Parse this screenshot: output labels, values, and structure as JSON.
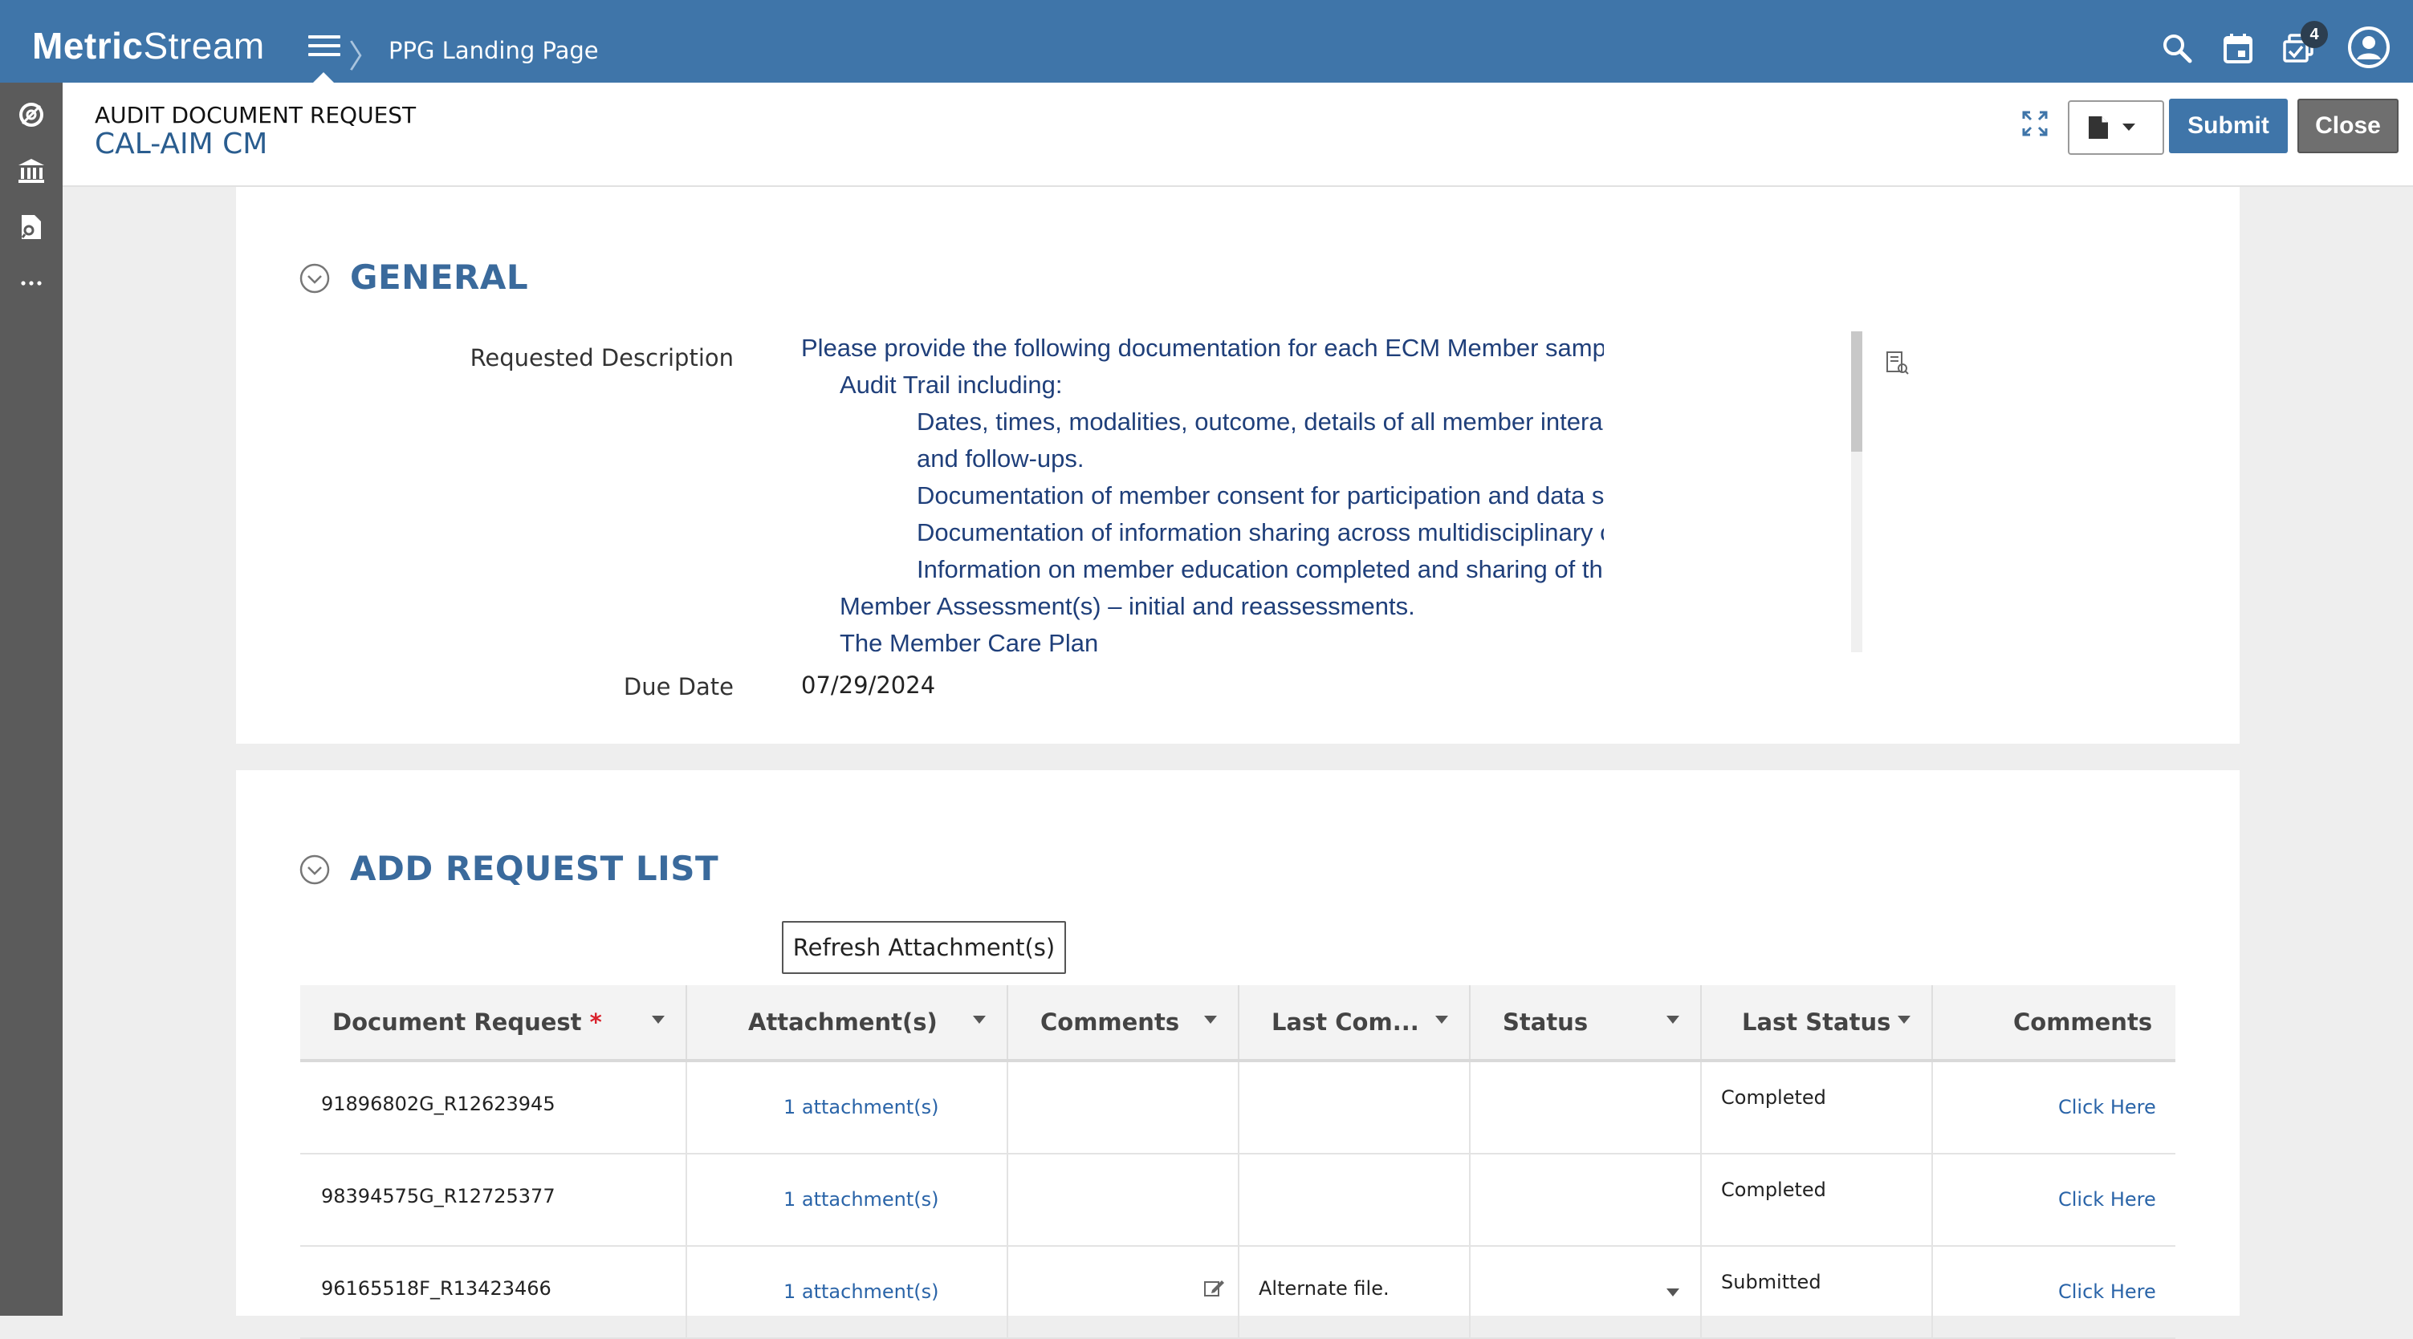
{
  "app": {
    "logo_bold": "Metric",
    "logo_light": "Stream",
    "breadcrumb": "PPG Landing Page",
    "notification_count": "4"
  },
  "header": {
    "subtitle": "AUDIT DOCUMENT REQUEST",
    "title": "CAL-AIM CM",
    "submit_label": "Submit",
    "close_label": "Close"
  },
  "general": {
    "section_title": "GENERAL",
    "description_label": "Requested Description",
    "description_lines": [
      "Please provide the following documentation for each ECM Member sample requested:",
      "Audit Trail including:",
      "Dates, times, modalities, outcome, details of all member interactions, referrals,",
      "and follow-ups.",
      "Documentation of member consent for participation and data sharing.",
      "Documentation of information sharing across multidisciplinary care team.",
      "Information on member education completed and sharing of the care plan.",
      "Member Assessment(s) – initial and reassessments.",
      "The Member Care Plan"
    ],
    "due_date_label": "Due Date",
    "due_date_value": "07/29/2024"
  },
  "request_list": {
    "section_title": "ADD REQUEST LIST",
    "refresh_label": "Refresh Attachment(s)",
    "columns": {
      "document_request": "Document Request",
      "required_marker": "*",
      "attachments": "Attachment(s)",
      "comments": "Comments",
      "last_comment": "Last Com...",
      "status": "Status",
      "last_status": "Last Status",
      "comments2": "Comments"
    },
    "rows": [
      {
        "document_request": "91896802G_R12623945",
        "attachments": "1 attachment(s)",
        "comments": "",
        "last_comment": "",
        "status": "",
        "last_status": "Completed",
        "comments2": "Click Here"
      },
      {
        "document_request": "98394575G_R12725377",
        "attachments": "1 attachment(s)",
        "comments": "",
        "last_comment": "",
        "status": "",
        "last_status": "Completed",
        "comments2": "Click Here"
      },
      {
        "document_request": "96165518F_R13423466",
        "attachments": "1 attachment(s)",
        "comments": "",
        "last_comment": "Alternate file.",
        "status": "",
        "last_status": "Submitted",
        "comments2": "Click Here"
      }
    ]
  },
  "colors": {
    "topbar": "#3f75a9",
    "rail": "#5b5b5b",
    "section_title": "#3a6a9c",
    "link": "#2a64a8",
    "required": "#d9232d"
  }
}
